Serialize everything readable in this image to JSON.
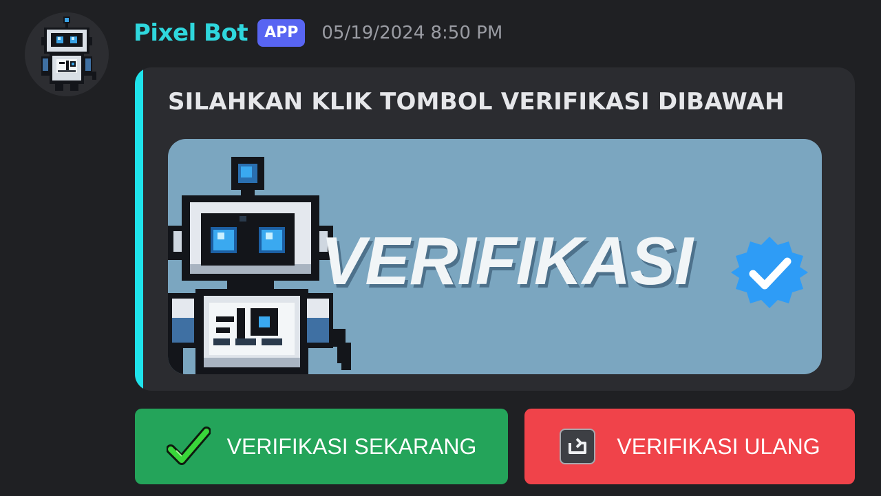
{
  "message": {
    "author": "Pixel Bot",
    "tag": "APP",
    "timestamp": "05/19/2024 8:50 PM",
    "avatar_icon": "pixel-robot-icon"
  },
  "embed": {
    "accent_color": "#1fe3eb",
    "title": "SILAHKAN KLIK TOMBOL VERIFIKASI DIBAWAH",
    "image": {
      "banner_text": "VERIFIKASI",
      "robot_icon": "pixel-robot-icon",
      "badge_icon": "verified-check-badge-icon",
      "background_color": "#7ba6c0"
    }
  },
  "buttons": [
    {
      "label": "VERIFIKASI SEKARANG",
      "icon": "green-check-icon",
      "color": "#24a45a"
    },
    {
      "label": "VERIFIKASI ULANG",
      "icon": "repeat-icon",
      "color": "#f0434a"
    }
  ]
}
